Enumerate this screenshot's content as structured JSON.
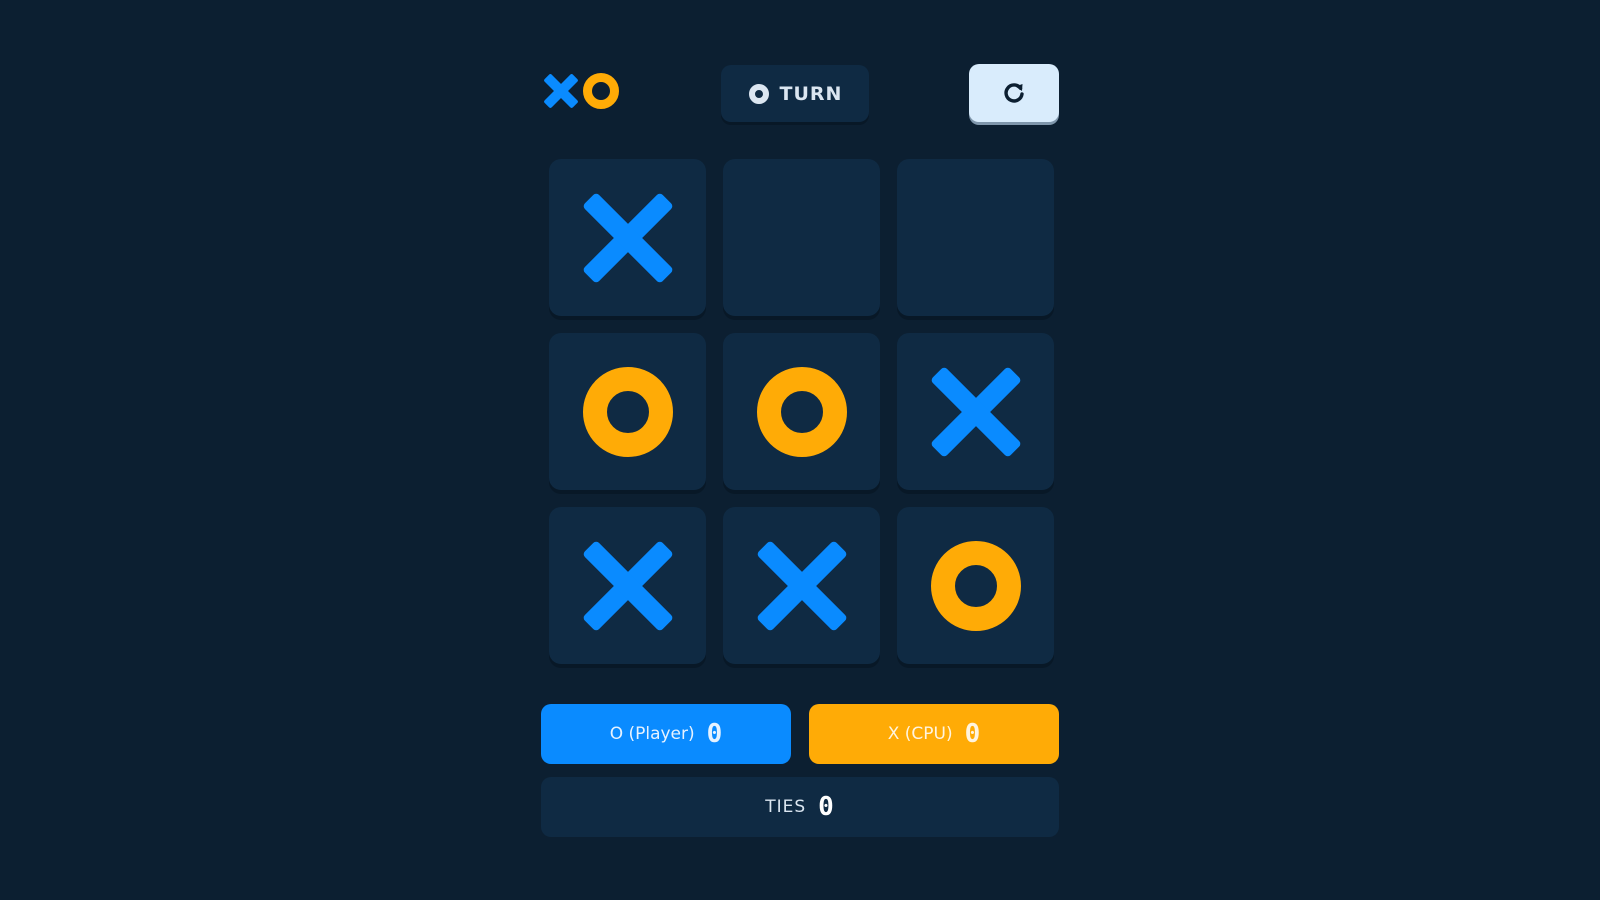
{
  "turn": {
    "label": "TURN",
    "player": "O"
  },
  "board": {
    "cells": [
      "X",
      "",
      "",
      "O",
      "O",
      "X",
      "X",
      "X",
      "O"
    ]
  },
  "scores": {
    "o": {
      "label": "O (Player)",
      "value": "0"
    },
    "x": {
      "label": "X (CPU)",
      "value": "0"
    },
    "ties": {
      "label": "TIES",
      "value": "0"
    }
  },
  "colors": {
    "background": "#0c1f31",
    "x_mark": "#0a8bff",
    "o_mark": "#ffab06",
    "cell": "#0f2a43",
    "restart": "#d9ecfc"
  },
  "icons": {
    "logo": "xo-logo",
    "turn": "o-icon",
    "restart": "restart-icon"
  }
}
